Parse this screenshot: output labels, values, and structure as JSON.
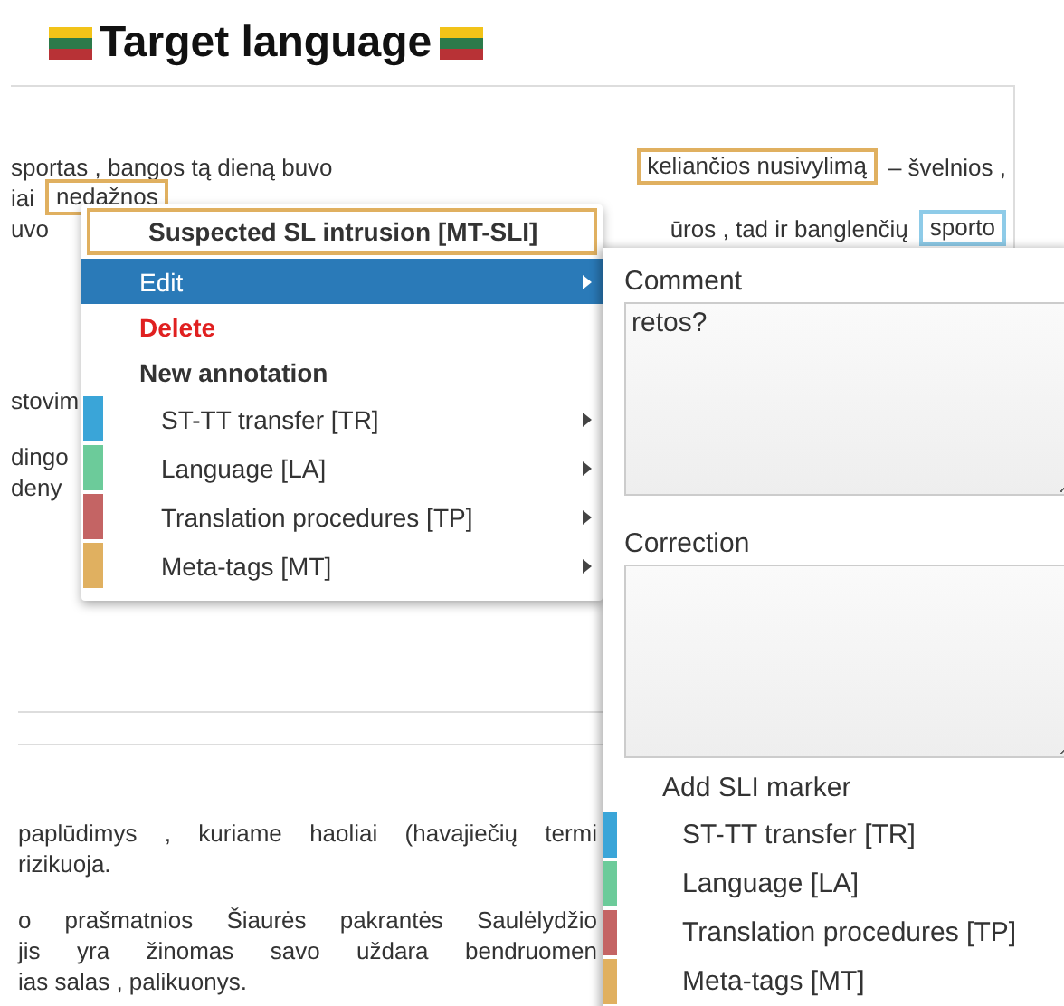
{
  "heading": {
    "title": "Target language"
  },
  "upper_text": [
    {
      "lines": [
        [
          {
            "text": "sportas , bangos tą dieną buvo"
          },
          {
            "text": "keliančios nusivylimą",
            "color": "#e0b060"
          },
          {
            "text": "– švelnios ,"
          }
        ],
        [
          {
            "text": "iai"
          },
          {
            "text": "nedažnos",
            "color": "#e0b060"
          }
        ]
      ]
    },
    {
      "lines": [
        [
          {
            "text": "uvo"
          },
          {
            "text": "ūros , tad ir banglenčių"
          },
          {
            "text": "sporto",
            "color": "#8ecbe8"
          }
        ]
      ]
    },
    {
      "lines": [
        [
          {
            "text": "stovim"
          }
        ]
      ]
    },
    {
      "lines": [
        [
          {
            "text": "dingo"
          }
        ],
        [
          {
            "text": "deny"
          }
        ]
      ]
    }
  ],
  "lower_text": [
    {
      "lines": [
        [
          {
            "text": "paplūdimys , kuriame haoliai (havajiečių termi"
          }
        ],
        [
          {
            "text": "rizikuoja."
          }
        ]
      ]
    },
    {
      "lines": [
        [
          {
            "text": "o prašmatnios Šiaurės pakrantės Saulėlydžio"
          }
        ],
        [
          {
            "text": "jis yra žinomas savo uždara bendruomen"
          }
        ],
        [
          {
            "text": "ias salas , palikuonys."
          }
        ]
      ]
    }
  ],
  "context_menu": {
    "title": "Suspected SL intrusion [MT-SLI]",
    "items": [
      {
        "kind": "action",
        "label": "Edit",
        "selected": true,
        "submenu": true
      },
      {
        "kind": "danger",
        "label": "Delete",
        "selected": false,
        "submenu": false
      },
      {
        "kind": "header",
        "label": "New annotation"
      },
      {
        "kind": "category",
        "label": "ST-TT transfer [TR]",
        "color": "#3aa5d8",
        "selected": false,
        "submenu": true
      },
      {
        "kind": "category",
        "label": "Language [LA]",
        "color": "#6ccb9a",
        "selected": false,
        "submenu": true
      },
      {
        "kind": "category",
        "label": "Translation procedures [TP]",
        "color": "#c46464",
        "selected": false,
        "submenu": true
      },
      {
        "kind": "category",
        "label": "Meta-tags [MT]",
        "color": "#e0b060",
        "selected": false,
        "submenu": true
      }
    ]
  },
  "edit_panel": {
    "comment": {
      "label": "Comment",
      "value": "retos?"
    },
    "correction": {
      "label": "Correction"
    },
    "sli_marker": {
      "label": "Add SLI marker",
      "items": [
        {
          "label": "ST-TT transfer [TR]",
          "color": "#3aa5d8"
        },
        {
          "label": "Language [LA]",
          "color": "#6ccb9a"
        },
        {
          "label": "Translation procedures [TP]",
          "color": "#c46464"
        },
        {
          "label": "Meta-tags [MT]",
          "color": "#e0b060"
        }
      ]
    }
  }
}
